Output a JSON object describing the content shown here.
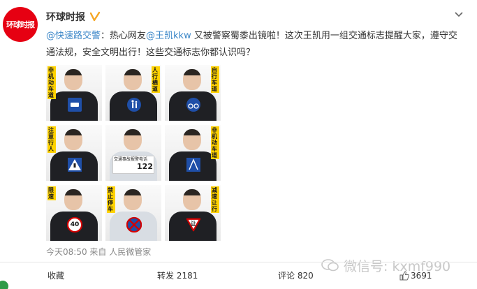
{
  "post": {
    "account_name": "环球时报",
    "avatar_text": "环球时报",
    "verified_icon": "verified-v-icon",
    "text_mention_1": "@快速路交警",
    "text_part_1": "：热心网友",
    "text_mention_2": "@王凯kkw",
    "text_part_2": " 又被警察蜀黍出镜啦！这次王凯用一组交通标志提醒大家，遵守交通法规，安全文明出行！这些交通标志你都认识吗？",
    "timestamp": "今天08:50",
    "source_prefix": "来自",
    "source": "人民微管家"
  },
  "grid": {
    "captions": [
      "非机动车道",
      "人行横道",
      "自行车道",
      "注意行人",
      "",
      "非机动车道",
      "限速",
      "禁止停车",
      "减速让行"
    ],
    "sign_122_text": "122",
    "sign_122_caption": "交通事故报警电话",
    "speed_limit": "40",
    "yield_text": "让"
  },
  "actions": {
    "collect": "收藏",
    "repost": "转发 2181",
    "comment": "评论 820",
    "like": "3691"
  },
  "watermark": {
    "text": "微信号: kxmf990"
  }
}
